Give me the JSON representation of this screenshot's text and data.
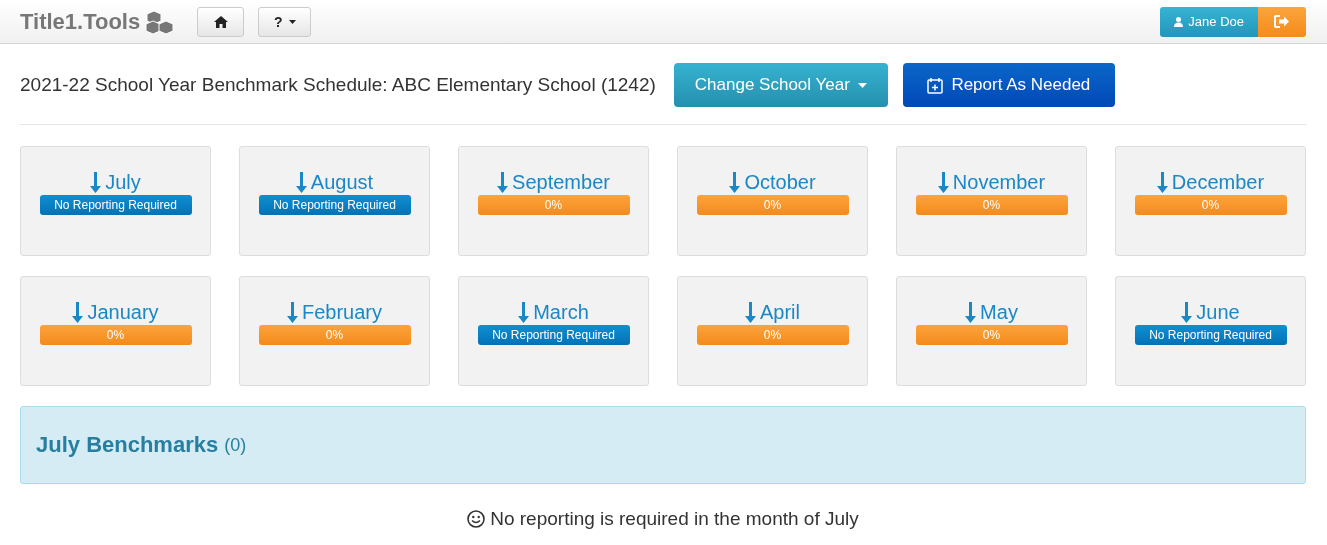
{
  "header": {
    "brand": "Title1.Tools",
    "help_button": "?",
    "user_button": "Jane Doe"
  },
  "title": "2021-22 School Year Benchmark Schedule: ABC Elementary School (1242)",
  "buttons": {
    "change_year": "Change School Year",
    "report": "Report As Needed"
  },
  "months": [
    {
      "name": "July",
      "kind": "none",
      "status": "No Reporting Required"
    },
    {
      "name": "August",
      "kind": "none",
      "status": "No Reporting Required"
    },
    {
      "name": "September",
      "kind": "progress",
      "status": "0%"
    },
    {
      "name": "October",
      "kind": "progress",
      "status": "0%"
    },
    {
      "name": "November",
      "kind": "progress",
      "status": "0%"
    },
    {
      "name": "December",
      "kind": "progress",
      "status": "0%"
    },
    {
      "name": "January",
      "kind": "progress",
      "status": "0%"
    },
    {
      "name": "February",
      "kind": "progress",
      "status": "0%"
    },
    {
      "name": "March",
      "kind": "none",
      "status": "No Reporting Required"
    },
    {
      "name": "April",
      "kind": "progress",
      "status": "0%"
    },
    {
      "name": "May",
      "kind": "progress",
      "status": "0%"
    },
    {
      "name": "June",
      "kind": "none",
      "status": "No Reporting Required"
    }
  ],
  "panel": {
    "title": "July Benchmarks",
    "count": "(0)"
  },
  "message": "No reporting is required in the month of July"
}
